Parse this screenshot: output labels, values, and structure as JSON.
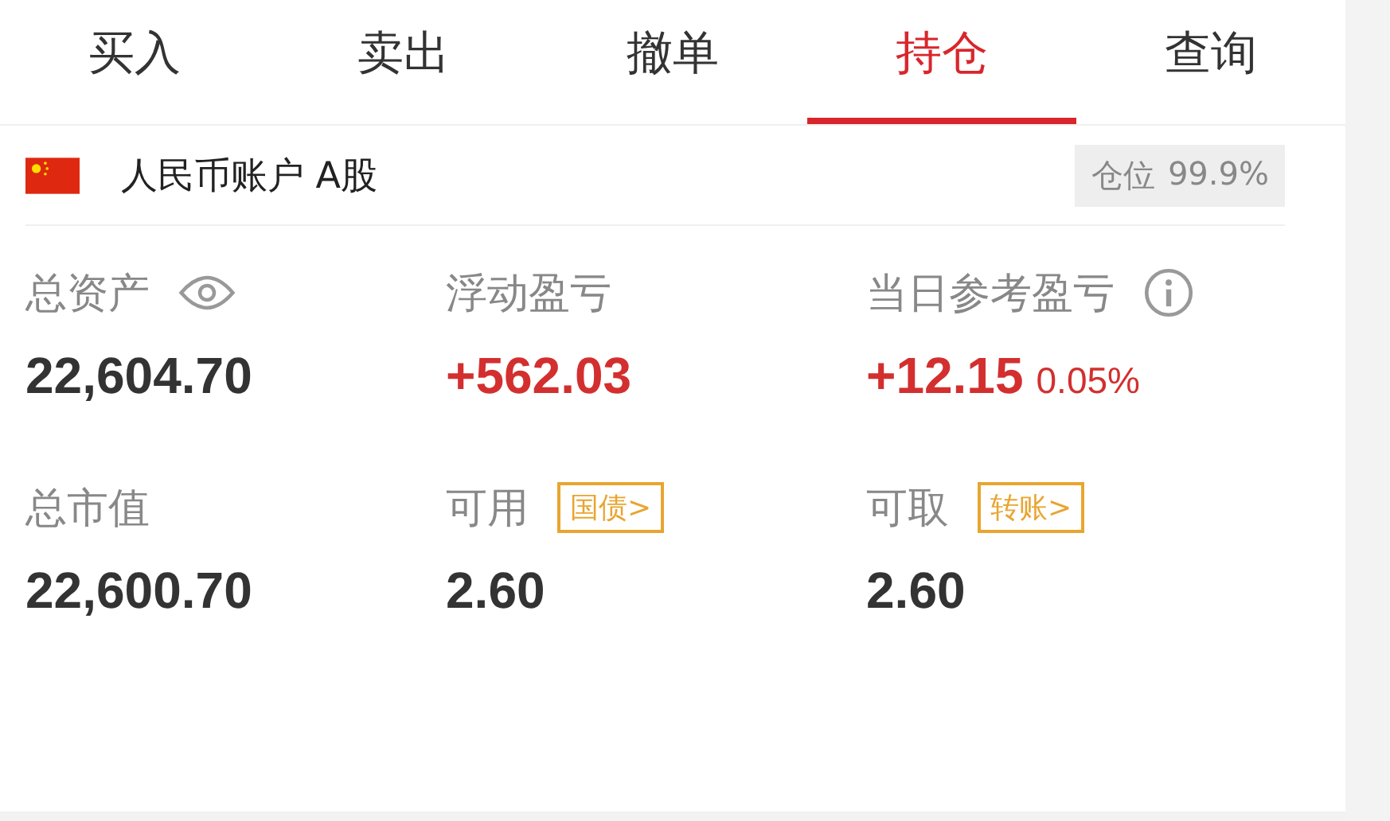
{
  "tabs": [
    {
      "label": "买入",
      "selected": false
    },
    {
      "label": "卖出",
      "selected": false
    },
    {
      "label": "撤单",
      "selected": false
    },
    {
      "label": "持仓",
      "selected": true
    },
    {
      "label": "查询",
      "selected": false
    }
  ],
  "account": {
    "name": "人民币账户 A股",
    "position_label": "仓位",
    "position_value": "99.9%"
  },
  "stats": [
    {
      "kind": "hidable",
      "label": "总资产",
      "value": "22,604.70",
      "gain": false
    },
    {
      "kind": "plain",
      "label": "浮动盈亏",
      "value": "+562.03",
      "gain": true
    },
    {
      "kind": "explained",
      "label": "当日参考盈亏",
      "value": "+12.15",
      "extra": "0.05%",
      "gain": true
    },
    {
      "kind": "plain",
      "label": "总市值",
      "value": "22,600.70",
      "gain": false
    },
    {
      "kind": "tagged",
      "label": "可用",
      "tag": "国债>",
      "value": "2.60",
      "gain": false
    },
    {
      "kind": "tagged",
      "label": "可取",
      "tag": "转账>",
      "value": "2.60",
      "gain": false
    }
  ]
}
